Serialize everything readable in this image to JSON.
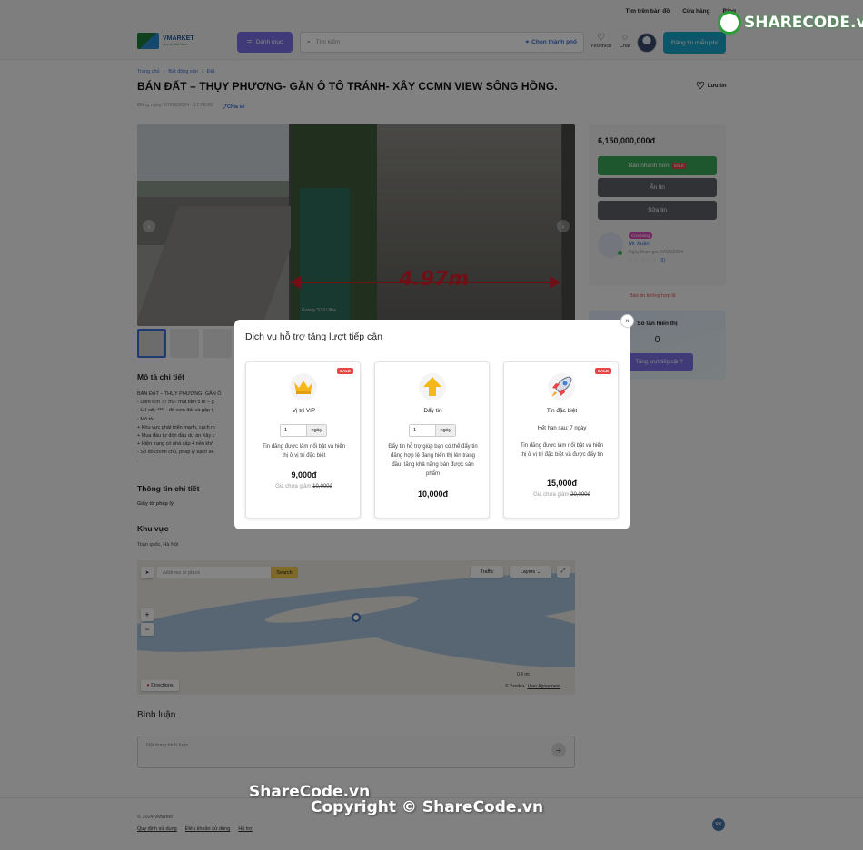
{
  "header": {
    "top_links": [
      "Tìm trên bản đồ",
      "Cửa hàng",
      "Blog"
    ],
    "logo_text": "VMARKET",
    "logo_sub": "Chợ số Việt Nam",
    "category_label": "Danh mục",
    "search_placeholder": "Tìm kiếm",
    "city_label": "Chọn thành phố",
    "favorites_label": "Yêu thích",
    "chat_label": "Chat",
    "post_button": "Đăng tin miễn phí"
  },
  "breadcrumb": [
    "Trang chủ",
    "Bất động sản",
    "Đất"
  ],
  "listing": {
    "title": "BÁN ĐẤT – THỤY PHƯƠNG- GẦN Ô TÔ TRÁNH- XÂY CCMN VIEW SÔNG HỒNG.",
    "save_label": "Lưu tin",
    "posted": "Đăng ngày: 07/05/2024 - 17:06:59",
    "share_label": "Chia sẻ",
    "photo_overlay": "4.97m",
    "photo_caption": "Galaxy S23 Ultra"
  },
  "description": {
    "title": "Mô tả chi tiết",
    "lines": [
      "BÁN ĐẤT – THỤY PHƯƠNG- GẦN Ô",
      "- Diện tích 77 m2- mặt tiền 5 m – g",
      "- LH sđt: *** – để xem đất và gặp t",
      "- Mô tả:",
      "+ Khu vực phát triển mạnh, cách m",
      "+ Mua đầu tư đón đầu dự án Xây c",
      "+ Hiện trạng có nhà cấp 4 nền khô",
      "- Sổ đỏ chính chủ, pháp lý sạch sẽ.",
      "."
    ],
    "details_title": "Thông tin chi tiết",
    "legal_label": "Giấy tờ pháp lý"
  },
  "sidebar": {
    "price": "6,150,000,000đ",
    "sell_fast": "Bán nhanh hơn",
    "sale_tag": "SALE",
    "hide_button": "Ẩn tin",
    "edit_button": "Sửa tin",
    "store_tag": "Cửa hàng",
    "seller_name": "Mr Xuân",
    "joined": "Ngày tham gia: 07/05/2024",
    "rating_count": "(0)",
    "report": "Báo tin không hợp lệ",
    "views_label": "Số lần hiển thị",
    "views_value": "0",
    "boost_button": "Tăng lượt tiếp cận?"
  },
  "region": {
    "title": "Khu vực",
    "location": "Toàn quốc, Hà Nội",
    "map_search_placeholder": "Address or place",
    "map_search_button": "Search",
    "traffic": "Traffic",
    "layers": "Layers",
    "directions": "Directions",
    "zoom_in": "+",
    "zoom_out": "−",
    "scale": "0.4 mi",
    "attribution": "© Yandex",
    "user_agreement": "User Agreement"
  },
  "comments": {
    "title": "Bình luận",
    "placeholder": "Nội dung bình luận"
  },
  "footer": {
    "copyright": "© 2024 vMarket",
    "links": [
      "Quy định sử dụng",
      "Điều khoản sử dụng",
      "Hỗ trợ"
    ],
    "vk": "VK"
  },
  "modal": {
    "title": "Dịch vụ hỗ trợ tăng lượt tiếp cận",
    "close": "×",
    "cards": [
      {
        "icon": "crown-icon",
        "sale": "SALE",
        "name": "Vị trí VIP",
        "qty": "1",
        "unit": "ngày",
        "desc": "Tin đăng được làm nổi bật và hiển thị ở vị trí đặc biệt",
        "price": "9,000đ",
        "old_label": "Giá chưa giảm",
        "old_price": "10,000đ"
      },
      {
        "icon": "up-arrow-icon",
        "name": "Đẩy tin",
        "qty": "1",
        "unit": "ngày",
        "desc": "Đẩy tin hỗ trợ giúp bạn có thể đẩy tin đăng hợp lệ đang hiển thị lên trang đầu, tăng khả năng bán được sản phẩm",
        "price": "10,000đ"
      },
      {
        "icon": "rocket-icon",
        "sale": "SALE",
        "name": "Tin đặc biệt",
        "expiry": "Hết hạn sau: 7 ngày",
        "desc": "Tin đăng được làm nổi bật và hiển thị ở vị trí đặc biệt và được đẩy tin",
        "price": "15,000đ",
        "old_label": "Giá chưa giảm",
        "old_price": "20,000đ"
      }
    ]
  },
  "watermark": {
    "brand": "SHARECODE.vn",
    "line1": "ShareCode.vn",
    "line2": "Copyright © ShareCode.vn"
  },
  "colors": {
    "accent": "#7b6fe6",
    "post_button": "#1aa6c9",
    "sell_fast": "#3aa757",
    "dark_button": "#5d6166",
    "sale": "#e84545"
  }
}
